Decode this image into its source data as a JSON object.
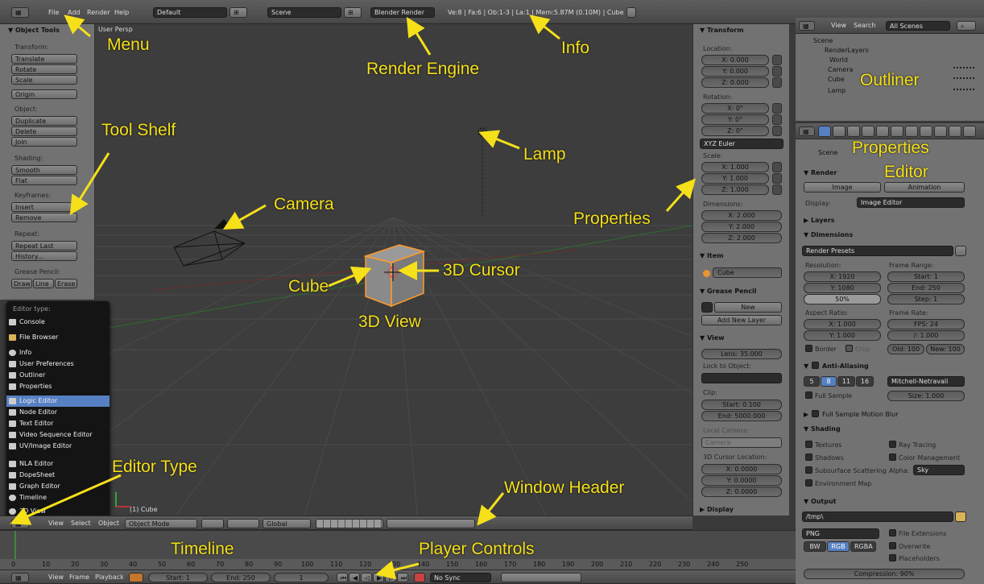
{
  "info_header": {
    "menus": [
      "File",
      "Add",
      "Render",
      "Help"
    ],
    "layout": "Default",
    "scene": "Scene",
    "render_engine": "Blender Render",
    "stats": "Ve:8 | Fa:6 | Ob:1-3 | La:1 | Mem:5.87M (0.10M) | Cube"
  },
  "tool_shelf": {
    "title": "▼ Object Tools",
    "transform_label": "Transform:",
    "translate": "Translate",
    "rotate": "Rotate",
    "scale": "Scale",
    "origin": "Origin",
    "object_label": "Object:",
    "duplicate": "Duplicate",
    "delete": "Delete",
    "join": "Join",
    "shading_label": "Shading:",
    "smooth": "Smooth",
    "flat": "Flat",
    "keyframes_label": "Keyframes:",
    "insert": "Insert",
    "remove": "Remove",
    "repeat_label": "Repeat:",
    "repeat_last": "Repeat Last",
    "history": "History...",
    "grease_label": "Grease Pencil:",
    "draw": "Draw",
    "line": "Line",
    "erase": "Erase"
  },
  "editor_menu": {
    "title": "Editor type:",
    "items": [
      "Console",
      "File Browser",
      "Info",
      "User Preferences",
      "Outliner",
      "Properties",
      "Logic Editor",
      "Node Editor",
      "Text Editor",
      "Video Sequence Editor",
      "UV/Image Editor",
      "NLA Editor",
      "DopeSheet",
      "Graph Editor",
      "Timeline",
      "3D View"
    ],
    "selected": "Logic Editor"
  },
  "viewport": {
    "view_name": "User Persp",
    "object_name": "(1) Cube"
  },
  "view3d_header": {
    "view": "View",
    "select": "Select",
    "object": "Object",
    "mode": "Object Mode",
    "orientation": "Global"
  },
  "properties_panel": {
    "transform_title": "▼ Transform",
    "location_label": "Location:",
    "loc": [
      "X: 0.000",
      "Y: 0.000",
      "Z: 0.000"
    ],
    "rotation_label": "Rotation:",
    "rot": [
      "X: 0°",
      "Y: 0°",
      "Z: 0°"
    ],
    "rot_mode": "XYZ Euler",
    "scale_label": "Scale:",
    "scl": [
      "X: 1.000",
      "Y: 1.000",
      "Z: 1.000"
    ],
    "dimensions_label": "Dimensions:",
    "dim": [
      "X: 2.000",
      "Y: 2.000",
      "Z: 2.000"
    ],
    "item_title": "▼ Item",
    "item_name": "Cube",
    "grease_title": "▼ Grease Pencil",
    "new": "New",
    "add_layer": "Add New Layer",
    "view_title": "▼ View",
    "lens": "Lens: 35.000",
    "lock_label": "Lock to Object:",
    "clip_label": "Clip:",
    "clip_start": "Start: 0.100",
    "clip_end": "End: 5000.000",
    "local_camera": "Local Camera:",
    "camera": "Camera",
    "cursor_label": "3D Cursor Location:",
    "cursor": [
      "X: 0.0000",
      "Y: 0.0000",
      "Z: 0.0000"
    ],
    "display_title": "▶ Display"
  },
  "outliner": {
    "view": "View",
    "search": "Search",
    "filter": "All Scenes",
    "items": [
      "Scene",
      "RenderLayers",
      "World",
      "Camera",
      "Cube",
      "Lamp"
    ]
  },
  "props_editor": {
    "scene": "Scene",
    "render_title": "▼ Render",
    "image": "Image",
    "animation": "Animation",
    "display_label": "Display:",
    "display_value": "Image Editor",
    "layers_title": "▶ Layers",
    "dimensions_title": "▼ Dimensions",
    "presets": "Render Presets",
    "resolution_label": "Resolution:",
    "res_x": "X: 1920",
    "res_y": "Y: 1080",
    "res_pct": "50%",
    "frame_range_label": "Frame Range:",
    "start": "Start: 1",
    "end": "End: 250",
    "step": "Step: 1",
    "aspect_label": "Aspect Ratio:",
    "asp_x": "X: 1.000",
    "asp_y": "Y: 1.000",
    "frame_rate_label": "Frame Rate:",
    "fps": "FPS: 24",
    "fps_base": "/: 1.000",
    "border": "Border",
    "crop": "Crop",
    "old": "Old: 100",
    "new": "New: 100",
    "aa_title": "Anti-Aliasing",
    "aa_samples": [
      "5",
      "8",
      "11",
      "16"
    ],
    "aa_filter": "Mitchell-Netravali",
    "full_sample": "Full Sample",
    "aa_size": "Size: 1.000",
    "motion_blur": "Full Sample Motion Blur",
    "shading_title": "▼ Shading",
    "textures": "Textures",
    "ray_tracing": "Ray Tracing",
    "shadows": "Shadows",
    "color_mgmt": "Color Management",
    "sss": "Subsurface Scattering",
    "alpha_label": "Alpha:",
    "alpha_value": "Sky",
    "env_map": "Environment Map",
    "output_title": "▼ Output",
    "output_path": "/tmp\\",
    "format": "PNG",
    "file_ext": "File Extensions",
    "bw": "BW",
    "rgb": "RGB",
    "rgba": "RGBA",
    "overwrite": "Overwrite",
    "placeholders": "Placeholders",
    "compression": "Compression: 90%"
  },
  "timeline": {
    "ticks": [
      "0",
      "10",
      "20",
      "30",
      "40",
      "50",
      "60",
      "70",
      "80",
      "90",
      "100",
      "110",
      "120",
      "130",
      "140",
      "150",
      "160",
      "170",
      "180",
      "190",
      "200",
      "210",
      "220",
      "230",
      "240",
      "250"
    ],
    "view": "View",
    "frame": "Frame",
    "playback": "Playback",
    "start": "Start: 1",
    "end": "End: 250",
    "current": "1",
    "sync": "No Sync"
  },
  "annotations": {
    "menu": "Menu",
    "render_engine": "Render Engine",
    "info": "Info",
    "outliner": "Outliner",
    "tool_shelf": "Tool Shelf",
    "lamp": "Lamp",
    "properties_editor_1": "Properties",
    "properties_editor_2": "Editor",
    "camera": "Camera",
    "properties": "Properties",
    "cube": "Cube",
    "cursor3d": "3D Cursor",
    "view3d": "3D View",
    "editor_type": "Editor Type",
    "window_header": "Window Header",
    "timeline": "Timeline",
    "player_controls": "Player Controls"
  },
  "colors": {
    "annotation": "#f5e01a",
    "selection": "#5680c2",
    "cube_outline": "#ff9a2a"
  }
}
